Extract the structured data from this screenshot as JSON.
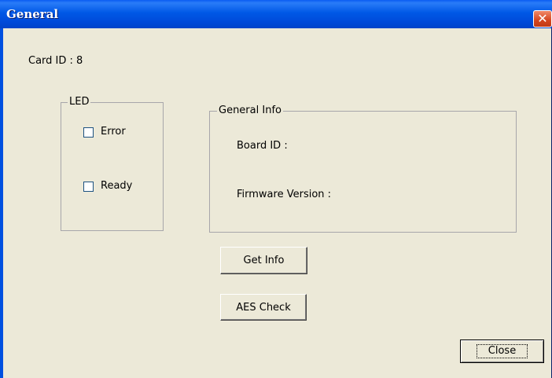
{
  "window": {
    "title": "General",
    "close_glyph": "✕"
  },
  "card_id_label": "Card ID : 8",
  "led": {
    "legend": "LED",
    "error_label": "Error",
    "error_checked": false,
    "ready_label": "Ready",
    "ready_checked": false
  },
  "general_info": {
    "legend": "General Info",
    "board_id_label": "Board ID :",
    "firmware_label": "Firmware Version :"
  },
  "buttons": {
    "get_info": "Get Info",
    "aes_check": "AES Check",
    "close": "Close"
  },
  "colors": {
    "titlebar": "#0058e6",
    "dialog_bg": "#ece9d8",
    "close_red": "#d4451f"
  },
  "icons": {
    "window_close": "close-icon"
  }
}
